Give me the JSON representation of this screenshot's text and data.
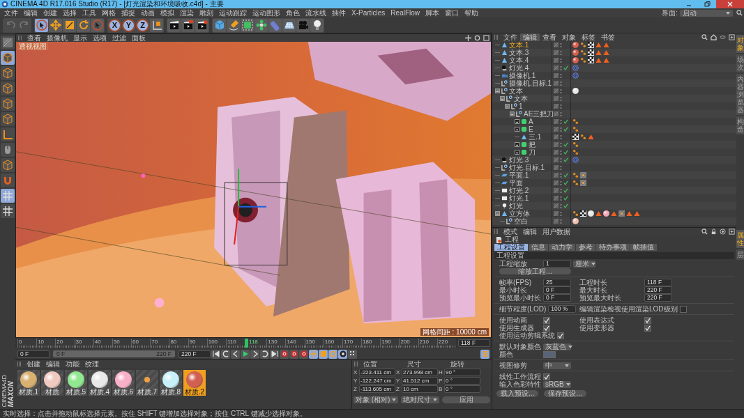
{
  "window": {
    "title": "CINEMA 4D R17.016 Studio (R17) - [灯光渲染和环境吸收.c4d] - 主要"
  },
  "menu": [
    "文件",
    "编辑",
    "创建",
    "选择",
    "工具",
    "网格",
    "捕捉",
    "动画",
    "模拟",
    "渲染",
    "雕刻",
    "运动跟踪",
    "运动图形",
    "角色",
    "流水线",
    "插件",
    "X-Particles",
    "RealFlow",
    "脚本",
    "窗口",
    "帮助"
  ],
  "layout_selector": {
    "label": "界面:",
    "value": "启动"
  },
  "toolbar": {
    "history": [
      {
        "kind": "undo",
        "disabled": true
      },
      {
        "kind": "redo",
        "disabled": true
      }
    ],
    "tools": [
      {
        "kind": "live-select",
        "selected": true
      },
      {
        "kind": "move",
        "selected": false
      },
      {
        "kind": "scale",
        "selected": false
      },
      {
        "kind": "rotate",
        "selected": false
      },
      {
        "kind": "last-select",
        "selected": false
      }
    ],
    "axes": [
      {
        "label": "X",
        "on": true
      },
      {
        "label": "Y",
        "on": true
      },
      {
        "label": "Z",
        "on": true
      }
    ]
  },
  "left_tools": [
    {
      "kind": "viewport",
      "selected": false
    },
    {
      "kind": "cube",
      "selected": true
    },
    {
      "kind": "cube",
      "selected": false
    },
    {
      "kind": "cube",
      "selected": false
    },
    {
      "kind": "cube",
      "selected": false
    },
    {
      "kind": "cube",
      "selected": false
    },
    {
      "kind": "axis",
      "selected": false
    },
    {
      "kind": "mouse",
      "selected": false
    },
    {
      "kind": "cube",
      "selected": false
    },
    {
      "kind": "magnet",
      "selected": false
    },
    {
      "kind": "grid",
      "selected": true
    },
    {
      "kind": "grid",
      "selected": false
    }
  ],
  "viewport": {
    "menu": [
      "查看",
      "摄像机",
      "显示",
      "选项",
      "过滤",
      "面板"
    ],
    "name": "透视视图",
    "grid_spacing": "网格间距 : 10000 cm"
  },
  "timeline": {
    "frames": [
      {
        "label": "0",
        "current": false
      },
      {
        "label": "10",
        "current": false
      },
      {
        "label": "20",
        "current": false
      },
      {
        "label": "30",
        "current": false
      },
      {
        "label": "40",
        "current": false
      },
      {
        "label": "50",
        "current": false
      },
      {
        "label": "60",
        "current": false
      },
      {
        "label": "70",
        "current": false
      },
      {
        "label": "80",
        "current": false
      },
      {
        "label": "90",
        "current": false
      },
      {
        "label": "100",
        "current": false
      },
      {
        "label": "110",
        "current": false
      },
      {
        "label": "118",
        "current": true
      },
      {
        "label": "130",
        "current": false
      },
      {
        "label": "140",
        "current": false
      },
      {
        "label": "150",
        "current": false
      },
      {
        "label": "160",
        "current": false
      },
      {
        "label": "170",
        "current": false
      },
      {
        "label": "180",
        "current": false
      },
      {
        "label": "190",
        "current": false
      },
      {
        "label": "200",
        "current": false
      },
      {
        "label": "210",
        "current": false
      },
      {
        "label": "220",
        "current": false
      }
    ],
    "current_field": "118 F"
  },
  "transport": {
    "start_field": "0 F",
    "range": {
      "start": "0 F",
      "end": "220 F",
      "level": 1
    },
    "end_field": "220 F"
  },
  "materials": {
    "menu": [
      "创建",
      "编辑",
      "功能",
      "纹理"
    ],
    "items": [
      {
        "name": "材质.1",
        "kind": "sphere",
        "color": "#d8b070",
        "selected": false
      },
      {
        "name": "材质",
        "kind": "sphere",
        "color": "#f0c8c0",
        "selected": false
      },
      {
        "name": "材质.5",
        "kind": "sphere",
        "color": "#90e890",
        "selected": false
      },
      {
        "name": "材质.4",
        "kind": "sphere",
        "color": "#e8e8e8",
        "selected": false
      },
      {
        "name": "材质.6",
        "kind": "sphere",
        "color": "#f8b0c8",
        "selected": false
      },
      {
        "name": "材质.7",
        "kind": "texture",
        "color": "#f0a040",
        "selected": false
      },
      {
        "name": "材质.8",
        "kind": "sphere",
        "color": "#c8f0f8",
        "selected": false
      },
      {
        "name": "材质.2",
        "kind": "sphere",
        "color": "#d06050",
        "selected": true
      }
    ]
  },
  "coordinates": {
    "headers": [
      "位置",
      "尺寸",
      "旋转"
    ],
    "rows": [
      [
        {
          "axis": "X",
          "value": "-223.411 cm"
        },
        {
          "axis": "X",
          "value": "273.998 cm"
        },
        {
          "axis": "H",
          "value": "90 °"
        }
      ],
      [
        {
          "axis": "Y",
          "value": "-122.247 cm"
        },
        {
          "axis": "Y",
          "value": "41.512 cm"
        },
        {
          "axis": "P",
          "value": "0 °"
        }
      ],
      [
        {
          "axis": "Z",
          "value": "-113.605 cm"
        },
        {
          "axis": "Z",
          "value": "10 cm"
        },
        {
          "axis": "B",
          "value": "0 °"
        }
      ]
    ],
    "dropdowns": [
      "对象 (相对)",
      "绝对尺寸"
    ],
    "apply": "应用"
  },
  "object_manager": {
    "menu": [
      {
        "label": "文件",
        "selected": false
      },
      {
        "label": "编辑",
        "selected": true
      },
      {
        "label": "查看",
        "selected": false
      },
      {
        "label": "对象",
        "selected": false
      },
      {
        "label": "标签",
        "selected": false
      },
      {
        "label": "书签",
        "selected": false
      }
    ],
    "objects": [
      {
        "name": "文本.1",
        "kind": "generator",
        "selected": true,
        "enabled": false,
        "tags": [
          {
            "kind": "material",
            "color": "#d86050"
          },
          {
            "kind": "phong"
          },
          {
            "kind": "checker"
          },
          {
            "kind": "warning"
          },
          {
            "kind": "warning"
          }
        ]
      },
      {
        "name": "文本.3",
        "kind": "generator",
        "selected": false,
        "enabled": false,
        "tags": [
          {
            "kind": "material",
            "color": "#d86050"
          },
          {
            "kind": "phong"
          },
          {
            "kind": "checker"
          },
          {
            "kind": "warning"
          },
          {
            "kind": "warning"
          }
        ]
      },
      {
        "name": "文本.4",
        "kind": "generator",
        "selected": false,
        "enabled": false,
        "tags": [
          {
            "kind": "material",
            "color": "#d86050"
          },
          {
            "kind": "phong"
          },
          {
            "kind": "checker"
          },
          {
            "kind": "warning"
          },
          {
            "kind": "warning"
          }
        ]
      },
      {
        "name": "灯光.4",
        "kind": "light",
        "selected": false,
        "enabled": true,
        "tags": [
          {
            "kind": "target"
          }
        ]
      },
      {
        "name": "摄像机.1",
        "kind": "camera",
        "selected": false,
        "enabled": false,
        "tags": [
          {
            "kind": "target"
          }
        ]
      },
      {
        "name": "摄像机.目标.1",
        "kind": "null",
        "selected": false,
        "enabled": false
      },
      {
        "name": "文本",
        "kind": "null",
        "selected": false,
        "enabled": false,
        "expanded": true,
        "tags": [
          {
            "kind": "material",
            "color": "#e8e8e8"
          }
        ],
        "children": [
          {
            "name": "文本",
            "kind": "null",
            "selected": false,
            "enabled": false,
            "expanded": true,
            "children": [
              {
                "name": "1",
                "kind": "null",
                "selected": false,
                "enabled": false,
                "expanded": true,
                "children": [
                  {
                    "name": "AE三把刀",
                    "kind": "null",
                    "selected": false,
                    "enabled": false,
                    "expanded": true,
                    "children": [
                      {
                        "name": "A",
                        "kind": "cloner",
                        "selected": false,
                        "enabled": true,
                        "expanded": false,
                        "tags": [
                          {
                            "kind": "phong"
                          }
                        ]
                      },
                      {
                        "name": "E",
                        "kind": "cloner",
                        "selected": false,
                        "enabled": true,
                        "expanded": false,
                        "tags": [
                          {
                            "kind": "phong"
                          }
                        ]
                      },
                      {
                        "name": "三.1",
                        "kind": "generator",
                        "selected": false,
                        "enabled": false,
                        "tags": [
                          {
                            "kind": "checker"
                          },
                          {
                            "kind": "phong"
                          },
                          {
                            "kind": "warning"
                          }
                        ]
                      },
                      {
                        "name": "把",
                        "kind": "cloner",
                        "selected": false,
                        "enabled": true,
                        "expanded": false,
                        "tags": [
                          {
                            "kind": "phong"
                          }
                        ]
                      },
                      {
                        "name": "刀",
                        "kind": "cloner",
                        "selected": false,
                        "enabled": true,
                        "expanded": false,
                        "tags": [
                          {
                            "kind": "phong"
                          }
                        ]
                      }
                    ]
                  }
                ]
              }
            ]
          }
        ]
      },
      {
        "name": "灯光.3",
        "kind": "light",
        "selected": false,
        "enabled": true,
        "tags": [
          {
            "kind": "target"
          }
        ]
      },
      {
        "name": "灯光.目标.1",
        "kind": "null",
        "selected": false,
        "enabled": false
      },
      {
        "name": "平面.1",
        "kind": "plane",
        "selected": false,
        "enabled": true,
        "tags": [
          {
            "kind": "phong"
          },
          {
            "kind": "texture"
          }
        ]
      },
      {
        "name": "平面",
        "kind": "plane",
        "selected": false,
        "enabled": true,
        "tags": [
          {
            "kind": "phong"
          },
          {
            "kind": "texture"
          }
        ]
      },
      {
        "name": "灯光.2",
        "kind": "area-light",
        "selected": false,
        "enabled": true
      },
      {
        "name": "灯光.1",
        "kind": "area-light",
        "selected": false,
        "enabled": true
      },
      {
        "name": "灯光",
        "kind": "bulb",
        "selected": false,
        "enabled": true
      },
      {
        "name": "立方体",
        "kind": "generator",
        "selected": false,
        "enabled": false,
        "expanded": true,
        "tags": [
          {
            "kind": "phong"
          },
          {
            "kind": "checker"
          },
          {
            "kind": "material",
            "color": "#e8e8e8"
          },
          {
            "kind": "warning"
          },
          {
            "kind": "material",
            "color": "#f4a8b8"
          },
          {
            "kind": "warning"
          },
          {
            "kind": "texture"
          },
          {
            "kind": "warning"
          },
          {
            "kind": "warning"
          }
        ],
        "children": [
          {
            "name": "空白",
            "kind": "null",
            "selected": false,
            "enabled": false,
            "tags": [
              {
                "kind": "material",
                "color": "#f0c0b0"
              }
            ]
          }
        ]
      }
    ],
    "side_tabs": [
      {
        "label": "对象",
        "selected": true
      },
      {
        "label": "场次",
        "selected": false
      },
      {
        "label": "内容浏览器",
        "selected": false
      },
      {
        "label": "构造",
        "selected": false
      }
    ]
  },
  "attributes": {
    "menu": [
      "模式",
      "编辑",
      "用户数据"
    ],
    "object": "工程",
    "tabs": [
      {
        "label": "工程设置",
        "selected": true
      },
      {
        "label": "信息",
        "selected": false
      },
      {
        "label": "动力学",
        "selected": false
      },
      {
        "label": "参考",
        "selected": false
      },
      {
        "label": "待办事项",
        "selected": false
      },
      {
        "label": "帧插值",
        "selected": false
      }
    ],
    "section": "工程设置",
    "scale": {
      "label": "工程缩放",
      "value": "1",
      "unit": "厘米"
    },
    "scale_button": "缩放工程...",
    "time_fields": [
      {
        "label": "帧率(FPS)",
        "value": "25"
      },
      {
        "label": "工程时长",
        "value": "118 F"
      },
      {
        "label": "最小时长",
        "value": "0 F"
      },
      {
        "label": "最大时长",
        "value": "220 F"
      },
      {
        "label": "预览最小时长",
        "value": "0 F"
      },
      {
        "label": "预览最大时长",
        "value": "220 F"
      }
    ],
    "lod": {
      "label": "细节程度(LOD)",
      "value": "100 %"
    },
    "render_lod": {
      "label": "编辑渲染检视使用渲染LOD级别",
      "checked": false
    },
    "checks": [
      {
        "label": "使用动画",
        "checked": true
      },
      {
        "label": "使用表达式",
        "checked": true
      },
      {
        "label": "使用生成器",
        "checked": true
      },
      {
        "label": "使用变形器",
        "checked": true
      },
      {
        "label": "使用运动剪辑系统",
        "checked": true
      }
    ],
    "default_color": {
      "label": "默认对象颜色",
      "value": "灰蓝色"
    },
    "color_label": "颜色",
    "view_clip": {
      "label": "视图修剪",
      "value": "中"
    },
    "linear": {
      "label": "线性工作流程",
      "checked": true
    },
    "input_color": {
      "label": "输入色彩特性",
      "value": "sRGB"
    },
    "buttons": [
      "载入预设...",
      "保存预设..."
    ],
    "side_tabs": [
      {
        "label": "属性",
        "selected": true
      },
      {
        "label": "层",
        "selected": false
      }
    ]
  },
  "logo": [
    "MAXON",
    "CINEMA4D"
  ],
  "status_bar": "实时选择：点击并拖动鼠标选择元素。按住 SHIFT 键增加选择对象；按住 CTRL 键减少选择对象。"
}
